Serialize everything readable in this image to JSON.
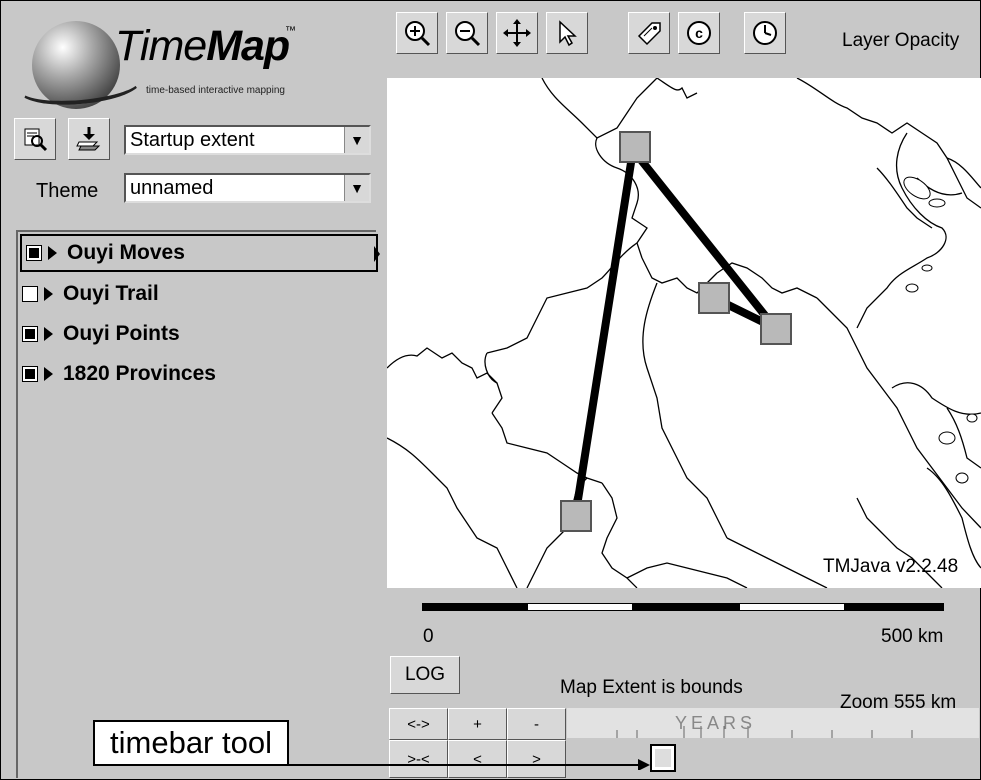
{
  "logo": {
    "name_part1": "Time",
    "name_part2": "Map",
    "trademark": "™",
    "tagline": "time-based interactive mapping"
  },
  "left_toolbar": {
    "extent_select": {
      "value": "Startup extent"
    },
    "theme": {
      "label": "Theme",
      "value": "unnamed"
    }
  },
  "layers": [
    {
      "label": "Ouyi Moves",
      "checked": true,
      "selected": true
    },
    {
      "label": "Ouyi Trail",
      "checked": false,
      "selected": false
    },
    {
      "label": "Ouyi Points",
      "checked": true,
      "selected": false
    },
    {
      "label": "1820 Provinces",
      "checked": true,
      "selected": false
    }
  ],
  "map_toolbar": {
    "icons": [
      "zoom-in-icon",
      "zoom-out-icon",
      "pan-icon",
      "select-arrow-icon",
      "tag-label-icon",
      "copyright-icon",
      "clock-icon"
    ],
    "layer_opacity_label": "Layer Opacity"
  },
  "map": {
    "version": "TMJava v2.2.48"
  },
  "scale": {
    "start": "0",
    "end": "500 km"
  },
  "status": {
    "log_button": "LOG",
    "extent_text": "Map Extent is bounds",
    "zoom_text": "Zoom  555 km"
  },
  "timebar": {
    "buttons_row1": [
      "<->",
      "+",
      "-"
    ],
    "buttons_row2": [
      ">-<",
      "<",
      ">"
    ],
    "years_label": "YEARS"
  },
  "callout": {
    "text": "timebar tool"
  }
}
